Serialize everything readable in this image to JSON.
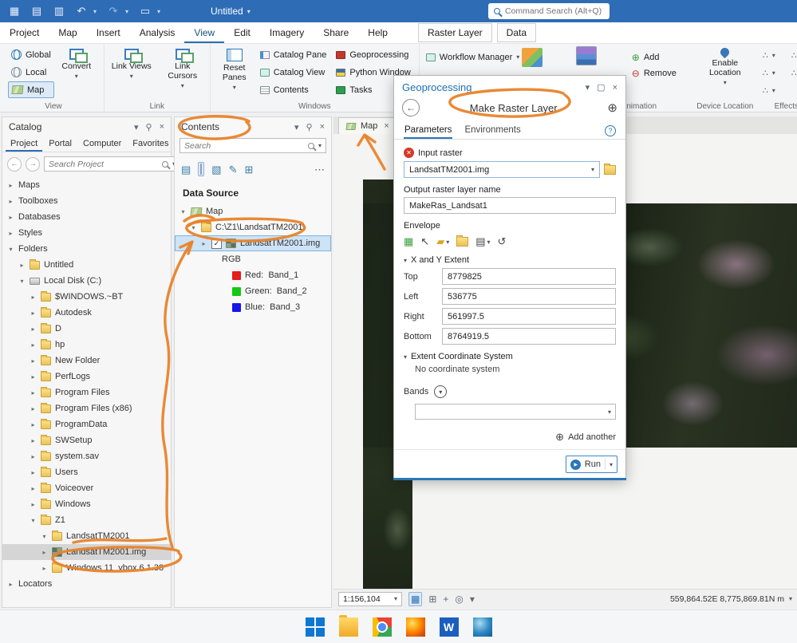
{
  "colors": {
    "accent": "#2b6cb5",
    "annotation": "#e8832a",
    "titlebar": "#2e6db6"
  },
  "titlebar": {
    "title": "Untitled",
    "command_search_placeholder": "Command Search (Alt+Q)"
  },
  "ribbon": {
    "tabs": [
      {
        "label": "Project"
      },
      {
        "label": "Map"
      },
      {
        "label": "Insert"
      },
      {
        "label": "Analysis"
      },
      {
        "label": "View",
        "cls": "active"
      },
      {
        "label": "Edit"
      },
      {
        "label": "Imagery"
      },
      {
        "label": "Share"
      },
      {
        "label": "Help"
      }
    ],
    "context_tabs": [
      {
        "label": "Raster Layer"
      },
      {
        "label": "Data"
      }
    ],
    "view_group": {
      "label": "View",
      "global": "Global",
      "local": "Local",
      "map": "Map",
      "convert": "Convert"
    },
    "link_group": {
      "label": "Link",
      "views": "Link Views",
      "cursors": "Link Cursors"
    },
    "windows_group": {
      "label": "Windows",
      "reset": "Reset Panes",
      "col1": [
        {
          "label": "Catalog Pane",
          "icon": "catalog-pane"
        },
        {
          "label": "Catalog View",
          "icon": "catalog-view"
        },
        {
          "label": "Contents",
          "icon": "contents"
        }
      ],
      "col2": [
        {
          "label": "Geoprocessing",
          "icon": "geoprocessing"
        },
        {
          "label": "Python Window",
          "icon": "python"
        },
        {
          "label": "Tasks",
          "icon": "tasks"
        }
      ],
      "workflow": "Workflow Manager"
    },
    "animation_group": {
      "label": "Animation",
      "add": "Add",
      "remove": "Remove"
    },
    "device_group": {
      "label": "Device Location",
      "enable": "Enable Location"
    },
    "effects_group": {
      "label": "Effects"
    }
  },
  "catalog": {
    "title": "Catalog",
    "tabs": [
      {
        "label": "Project",
        "cls": "active"
      },
      {
        "label": "Portal"
      },
      {
        "label": "Computer"
      },
      {
        "label": "Favorites"
      }
    ],
    "search_placeholder": "Search Project",
    "tree": [
      {
        "label": "Maps",
        "level": 0,
        "expand": "closed"
      },
      {
        "label": "Toolboxes",
        "level": 0,
        "expand": "closed"
      },
      {
        "label": "Databases",
        "level": 0,
        "expand": "closed"
      },
      {
        "label": "Styles",
        "level": 0,
        "expand": "closed"
      },
      {
        "label": "Folders",
        "level": 0,
        "expand": "open"
      },
      {
        "label": "Untitled",
        "level": 1,
        "expand": "closed",
        "icon": "folder"
      },
      {
        "label": "Local Disk (C:)",
        "level": 1,
        "expand": "open",
        "icon": "drive"
      },
      {
        "label": "$WINDOWS.~BT",
        "level": 2,
        "expand": "closed",
        "icon": "folder"
      },
      {
        "label": "Autodesk",
        "level": 2,
        "expand": "closed",
        "icon": "folder"
      },
      {
        "label": "D",
        "level": 2,
        "expand": "closed",
        "icon": "folder"
      },
      {
        "label": "hp",
        "level": 2,
        "expand": "closed",
        "icon": "folder"
      },
      {
        "label": "New Folder",
        "level": 2,
        "expand": "closed",
        "icon": "folder"
      },
      {
        "label": "PerfLogs",
        "level": 2,
        "expand": "closed",
        "icon": "folder"
      },
      {
        "label": "Program Files",
        "level": 2,
        "expand": "closed",
        "icon": "folder"
      },
      {
        "label": "Program Files (x86)",
        "level": 2,
        "expand": "closed",
        "icon": "folder"
      },
      {
        "label": "ProgramData",
        "level": 2,
        "expand": "closed",
        "icon": "folder"
      },
      {
        "label": "SWSetup",
        "level": 2,
        "expand": "closed",
        "icon": "folder"
      },
      {
        "label": "system.sav",
        "level": 2,
        "expand": "closed",
        "icon": "folder"
      },
      {
        "label": "Users",
        "level": 2,
        "expand": "closed",
        "icon": "folder"
      },
      {
        "label": "Voiceover",
        "level": 2,
        "expand": "closed",
        "icon": "folder"
      },
      {
        "label": "Windows",
        "level": 2,
        "expand": "closed",
        "icon": "folder"
      },
      {
        "label": "Z1",
        "level": 2,
        "expand": "open",
        "icon": "folder"
      },
      {
        "label": "LandsatTM2001",
        "level": 3,
        "expand": "open",
        "icon": "folder"
      },
      {
        "label": "LandsatTM2001.img",
        "level": 3,
        "expand": "closed",
        "icon": "raster",
        "cls": "sel-gray"
      },
      {
        "label": "Windows 11_vbox 6.1.38",
        "level": 3,
        "expand": "closed",
        "icon": "folder"
      },
      {
        "label": "Locators",
        "level": 0,
        "expand": "closed"
      }
    ]
  },
  "contents": {
    "title": "Contents",
    "search_placeholder": "Search",
    "section": "Data Source",
    "tree": [
      {
        "label": "Map",
        "level": 0,
        "expand": "open",
        "icon": "map"
      },
      {
        "label": "C:\\Z1\\LandsatTM2001\\",
        "level": 1,
        "expand": "open",
        "icon": "folder"
      },
      {
        "label": "LandsatTM2001.img",
        "level": 2,
        "expand": "closed",
        "icon": "raster",
        "cls": "sel-blue with-check"
      },
      {
        "label": "RGB",
        "level": 3
      },
      {
        "label": "Red:  Band_1",
        "level": 4,
        "icon": "sw-red"
      },
      {
        "label": "Green:  Band_2",
        "level": 4,
        "icon": "sw-green"
      },
      {
        "label": "Blue:  Band_3",
        "level": 4,
        "icon": "sw-blue"
      }
    ]
  },
  "map": {
    "tab": "Map",
    "scale": "1:156,104",
    "coordinates": "559,864.52E 8,775,869.81N m"
  },
  "gp": {
    "pane_title": "Geoprocessing",
    "tool_title": "Make Raster Layer",
    "tabs": [
      {
        "label": "Parameters",
        "cls": "active"
      },
      {
        "label": "Environments"
      }
    ],
    "input_raster_label": "Input raster",
    "input_raster_value": "LandsatTM2001.img",
    "output_label": "Output raster layer name",
    "output_value": "MakeRas_Landsat1",
    "envelope_label": "Envelope",
    "extent_section": "X and Y Extent",
    "extent_rows": [
      {
        "label": "Top",
        "value": "8779825"
      },
      {
        "label": "Left",
        "value": "536775"
      },
      {
        "label": "Right",
        "value": "561997.5"
      },
      {
        "label": "Bottom",
        "value": "8764919.5"
      }
    ],
    "extent_cs_section": "Extent Coordinate System",
    "extent_cs_value": "No coordinate system",
    "bands_label": "Bands",
    "add_another": "Add another",
    "run": "Run"
  },
  "taskbar": {
    "icons": [
      "windows",
      "file-explorer",
      "chrome",
      "firefox",
      "word",
      "arcgis-pro"
    ]
  }
}
